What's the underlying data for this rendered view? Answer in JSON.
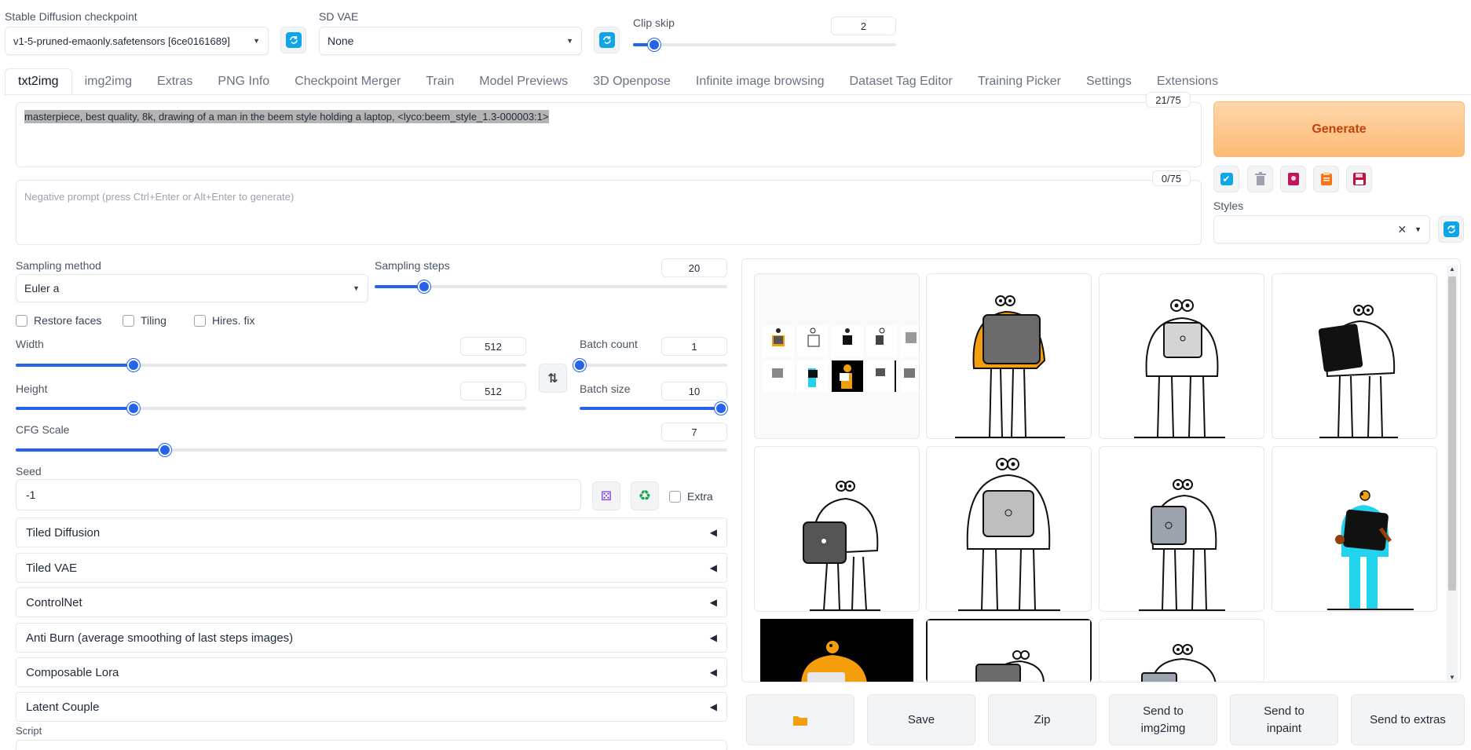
{
  "top": {
    "checkpoint_label": "Stable Diffusion checkpoint",
    "checkpoint_value": "v1-5-pruned-emaonly.safetensors [6ce0161689]",
    "vae_label": "SD VAE",
    "vae_value": "None",
    "clip_label": "Clip skip",
    "clip_value": "2",
    "clip_level": 0.08
  },
  "tabs": [
    "txt2img",
    "img2img",
    "Extras",
    "PNG Info",
    "Checkpoint Merger",
    "Train",
    "Model Previews",
    "3D Openpose",
    "Infinite image browsing",
    "Dataset Tag Editor",
    "Training Picker",
    "Settings",
    "Extensions"
  ],
  "prompt": {
    "text": "masterpiece, best quality, 8k, drawing of a man in the beem style holding a laptop, <lyco:beem_style_1.3-000003:1>",
    "token_count": "21/75",
    "negative_placeholder": "Negative prompt (press Ctrl+Enter or Alt+Enter to generate)",
    "negative_count": "0/75"
  },
  "side": {
    "generate_label": "Generate",
    "styles_label": "Styles"
  },
  "sampling": {
    "method_label": "Sampling method",
    "method_value": "Euler a",
    "steps_label": "Sampling steps",
    "steps_value": "20",
    "steps_level": 0.14
  },
  "checks": {
    "restore_faces": "Restore faces",
    "tiling": "Tiling",
    "hires": "Hires. fix"
  },
  "dims": {
    "width_label": "Width",
    "width_value": "512",
    "width_level": 0.23,
    "height_label": "Height",
    "height_value": "512",
    "height_level": 0.23,
    "batch_count_label": "Batch count",
    "batch_count_value": "1",
    "batch_count_level": 0.0,
    "batch_size_label": "Batch size",
    "batch_size_value": "10",
    "batch_size_level": 1.0
  },
  "cfg": {
    "label": "CFG Scale",
    "value": "7",
    "level": 0.21
  },
  "seed": {
    "label": "Seed",
    "value": "-1",
    "extra_label": "Extra"
  },
  "accordions": [
    "Tiled Diffusion",
    "Tiled VAE",
    "ControlNet",
    "Anti Burn (average smoothing of last steps images)",
    "Composable Lora",
    "Latent Couple"
  ],
  "script_label": "Script",
  "actions": {
    "save": "Save",
    "zip": "Zip",
    "img2img": "Send to img2img",
    "inpaint": "Send to inpaint",
    "extras": "Send to extras"
  },
  "colors": {
    "accent": "#2563eb",
    "generate_bg": "#fdba74",
    "generate_text": "#c2410c",
    "refresh_icon": "#0ea5e9",
    "figure_orange": "#f59e0b",
    "figure_cyan": "#22d3ee"
  },
  "icons": {
    "refresh": "refresh-icon",
    "swap": "swap-arrows-icon",
    "dice": "dice-icon",
    "recycle": "recycle-icon",
    "folder": "folder-icon"
  }
}
